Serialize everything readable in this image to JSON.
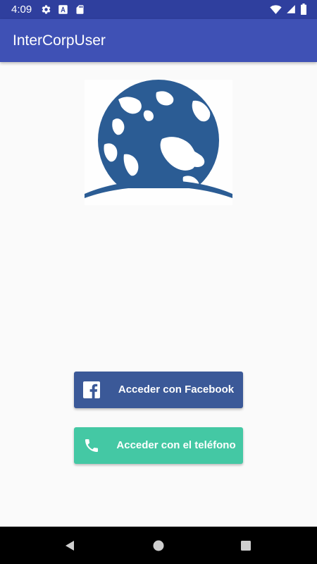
{
  "status_bar": {
    "time": "4:09",
    "icons_left": [
      "settings-gear-icon",
      "font-a-icon",
      "sd-card-icon"
    ],
    "icons_right": [
      "wifi-icon",
      "cell-signal-icon",
      "battery-icon"
    ]
  },
  "app_bar": {
    "title": "InterCorpUser",
    "color": "#3f51b5"
  },
  "logo": {
    "icon": "globe-logo-icon",
    "color": "#2b5c94"
  },
  "buttons": {
    "facebook": {
      "label": "Acceder con Facebook",
      "icon": "facebook-icon",
      "color": "#3b5998"
    },
    "phone": {
      "label": "Acceder con el teléfono",
      "icon": "phone-icon",
      "color": "#44c8a4"
    }
  },
  "nav_bar": {
    "buttons": [
      "back-icon",
      "home-icon",
      "recents-icon"
    ]
  }
}
